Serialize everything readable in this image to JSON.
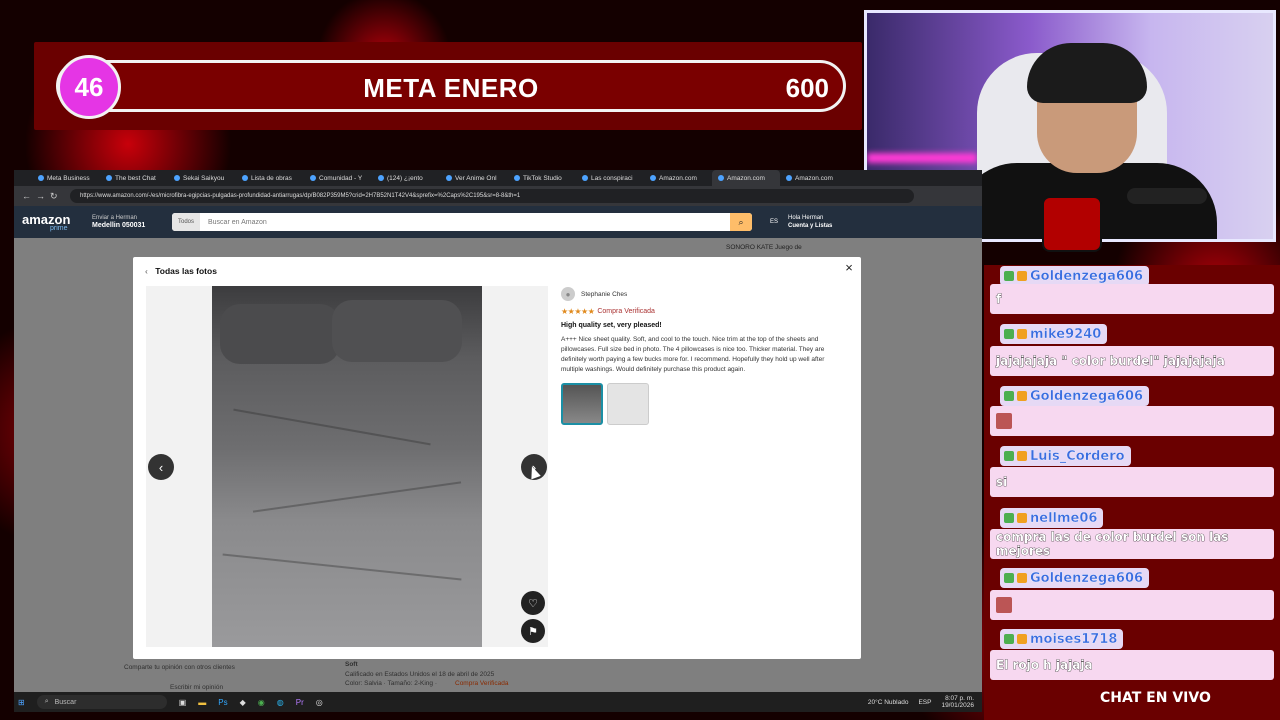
{
  "overlay": {
    "goal": {
      "current": "46",
      "title": "META ENERO",
      "target": "600",
      "progress_fraction": 0.077
    },
    "chat_footer": "CHAT EN VIVO"
  },
  "browser": {
    "tabs": [
      "Meta Business",
      "The best Chat",
      "Sekai Saikyou",
      "Lista de obras",
      "Comunidad - Y",
      "(124) ¿¡ento",
      "Ver Anime Onl",
      "TikTok Studio",
      "Las conspiraci",
      "Amazon.com",
      "Amazon.com",
      "Amazon.com"
    ],
    "url": "https://www.amazon.com/-/es/microfibra-egipcias-pulgadas-profundidad-antiarrugas/dp/B082P359M5?crid=2H7B52N1T42V4&sprefix=%2Caps%2C195&sr=8-8&th=1"
  },
  "amazon": {
    "logo": "amazon",
    "logo_sub": "prime",
    "deliver_label": "Enviar a Herman",
    "deliver_location": "Medellin 050031",
    "search_category": "Todos",
    "search_placeholder": "Buscar en Amazon",
    "lang": "ES",
    "account_line1": "Hola Herman",
    "account_line2": "Cuenta y Listas",
    "right_ad": "SONORO KATE Juego de",
    "bg_texts": {
      "share": "Comparte tu opinión con otros clientes",
      "write": "Escribir mi opinión",
      "soft": "Soft",
      "rated": "Calificado en Estados Unidos el 18 de abril de 2025",
      "color": "Color: Salvia · Tamaño: 2-King ·",
      "verified": "Compra Verificada"
    }
  },
  "modal": {
    "back_label": "Todas las fotos",
    "close_label": "×",
    "review": {
      "reviewer": "Stephanie Ches",
      "stars": "★★★★★",
      "verified": "Compra Verificada",
      "title": "High quality set, very pleased!",
      "body": "A+++ Nice sheet quality. Soft, and cool to the touch. Nice trim at the top of the sheets and pillowcases. Full size bed in photo. The 4 pillowcases is nice too. Thicker material. They are definitely worth paying a few bucks more for. I recommend. Hopefully they hold up well after multiple washings. Would definitely purchase this product again."
    }
  },
  "taskbar": {
    "search": "Buscar",
    "weather": "20°C Nublado",
    "lang": "ESP",
    "time": "8:07 p. m.",
    "date": "19/01/2026"
  },
  "chat": [
    {
      "user": "Goldenzega606",
      "text": "f",
      "top_name": 266,
      "top_body": 284
    },
    {
      "user": "mike9240",
      "text": "jajajajaja \" color burdel\" jajajajaja",
      "top_name": 324,
      "top_body": 346
    },
    {
      "user": "Goldenzega606",
      "text": "",
      "top_name": 386,
      "top_body": 406
    },
    {
      "user": "Luis_Cordero",
      "text": "si",
      "top_name": 446,
      "top_body": 467
    },
    {
      "user": "nellme06",
      "text": "compra las de color burdel son las mejores",
      "top_name": 508,
      "top_body": 529
    },
    {
      "user": "Goldenzega606",
      "text": "",
      "top_name": 568,
      "top_body": 590
    },
    {
      "user": "moises1718",
      "text": "El rojo h jajaja",
      "top_name": 629,
      "top_body": 650
    }
  ],
  "colors": {
    "accent": "#e535e5",
    "amazon_nav": "#232f3e",
    "chat_bg": "#6a0000",
    "username": "#3a6de0"
  }
}
